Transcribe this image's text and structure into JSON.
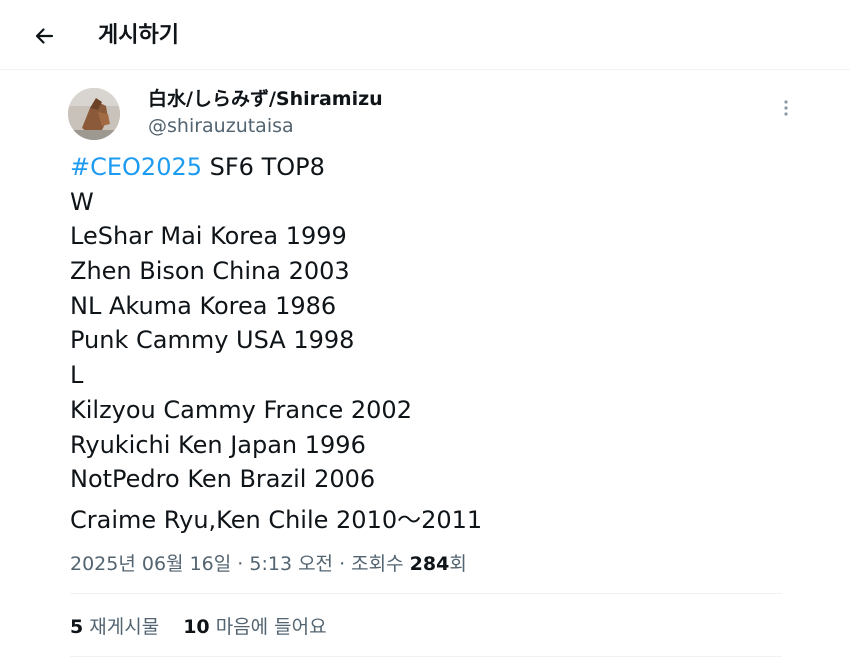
{
  "header": {
    "title": "게시하기"
  },
  "author": {
    "display_name": "白水/しらみず/Shiramizu",
    "handle": "@shirauzutaisa"
  },
  "tweet": {
    "hashtag": "#CEO2025",
    "first_line_rest": " SF6 TOP8",
    "lines": [
      "W",
      "LeShar Mai Korea 1999",
      "Zhen Bison China 2003",
      "NL Akuma Korea 1986",
      "Punk Cammy USA 1998",
      "L",
      "Kilzyou Cammy France 2002",
      "Ryukichi Ken Japan 1996",
      "NotPedro Ken Brazil 2006"
    ],
    "last_line": "Craime Ryu,Ken Chile 2010～2011"
  },
  "meta": {
    "date": "2025년 06월 16일",
    "sep": " · ",
    "time": "5:13 오전",
    "views_label": "조회수 ",
    "views_count": "284",
    "views_suffix": "회"
  },
  "stats": {
    "reposts_count": "5",
    "reposts_label": " 재게시물",
    "likes_count": "10",
    "likes_label": " 마음에 들어요"
  },
  "colors": {
    "text": "#0f1419",
    "secondary": "#536471",
    "accent": "#1d9bf0",
    "divider": "#eff3f4"
  },
  "icons": {
    "back": "arrow-left-icon",
    "more": "more-vertical-icon"
  }
}
